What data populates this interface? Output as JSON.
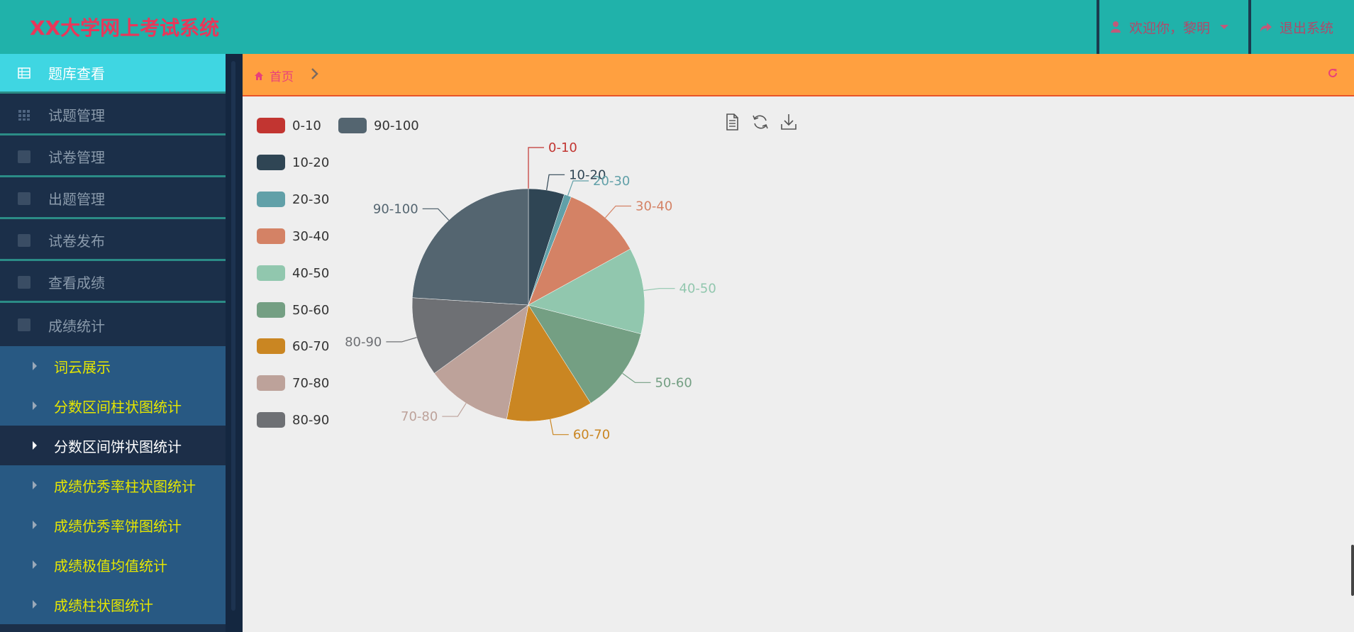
{
  "header": {
    "title": "XX大学网上考试系统",
    "user_label": "欢迎你，黎明",
    "logout_label": "退出系统",
    "colors": {
      "bar": "#20b2aa",
      "title": "#e8375a"
    }
  },
  "sidebar": {
    "items": [
      {
        "label": "题库查看",
        "active": true,
        "icon": "table-icon"
      },
      {
        "label": "试题管理",
        "icon": "grid-icon"
      },
      {
        "label": "试卷管理",
        "icon": "square-icon"
      },
      {
        "label": "出题管理",
        "icon": "square-icon"
      },
      {
        "label": "试卷发布",
        "icon": "square-icon"
      },
      {
        "label": "查看成绩",
        "icon": "square-icon"
      },
      {
        "label": "成绩统计",
        "icon": "square-icon"
      }
    ],
    "subitems": [
      {
        "label": "词云展示"
      },
      {
        "label": "分数区间柱状图统计"
      },
      {
        "label": "分数区间饼状图统计",
        "current": true
      },
      {
        "label": "成绩优秀率柱状图统计"
      },
      {
        "label": "成绩优秀率饼图统计"
      },
      {
        "label": "成绩极值均值统计"
      },
      {
        "label": "成绩柱状图统计"
      }
    ]
  },
  "breadcrumb": {
    "home": "首页"
  },
  "toolbox": [
    "data-view-icon",
    "restore-icon",
    "save-image-icon"
  ],
  "chart_data": {
    "type": "pie",
    "title": "",
    "categories": [
      "0-10",
      "10-20",
      "20-30",
      "30-40",
      "40-50",
      "50-60",
      "60-70",
      "70-80",
      "80-90",
      "90-100"
    ],
    "values": [
      0,
      5,
      1,
      11,
      12,
      12,
      12,
      12,
      11,
      24
    ],
    "colors": [
      "#c23531",
      "#2f4554",
      "#61a0a8",
      "#d48265",
      "#91c7ae",
      "#749f83",
      "#ca8622",
      "#bda29a",
      "#6e7074",
      "#546570"
    ],
    "legend": {
      "placement": "top-left",
      "items": [
        "0-10",
        "90-100",
        "10-20",
        "20-30",
        "30-40",
        "40-50",
        "50-60",
        "60-70",
        "70-80",
        "80-90"
      ]
    }
  }
}
